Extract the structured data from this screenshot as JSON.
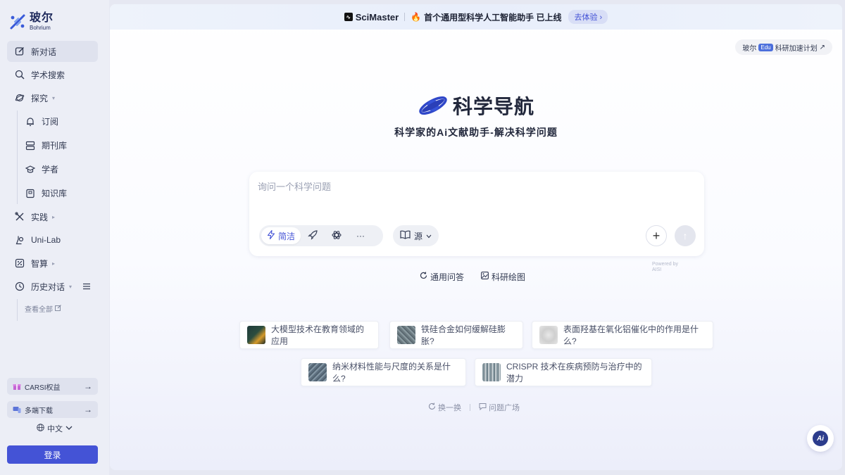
{
  "sidebar": {
    "logo_cn": "玻尔",
    "logo_en": "Bohrium",
    "items": [
      {
        "label": "新对话",
        "icon": "edit-icon"
      },
      {
        "label": "学术搜索",
        "icon": "search-icon"
      },
      {
        "label": "探究",
        "icon": "explore-icon"
      },
      {
        "label": "订阅",
        "icon": "bell-icon"
      },
      {
        "label": "期刊库",
        "icon": "database-icon"
      },
      {
        "label": "学者",
        "icon": "graduation-cap-icon"
      },
      {
        "label": "知识库",
        "icon": "notebook-icon"
      },
      {
        "label": "实践",
        "icon": "tools-icon"
      },
      {
        "label": "Uni-Lab",
        "icon": "lab-icon"
      },
      {
        "label": "智算",
        "icon": "compute-icon"
      },
      {
        "label": "历史对话",
        "icon": "history-icon"
      }
    ],
    "view_all": "查看全部",
    "carsi": "CARSI权益",
    "download": "多端下载",
    "language": "中文",
    "login": "登录"
  },
  "banner": {
    "product": "SciMaster",
    "title": "首个通用型科学人工智能助手 已上线",
    "try": "去体验"
  },
  "edu_chip": {
    "prefix": "玻尔",
    "badge": "Edu",
    "text": "科研加速计划"
  },
  "brand": {
    "title": "科学导航",
    "subtitle": "科学家的Ai文献助手-解决科学问题"
  },
  "ask": {
    "placeholder": "询问一个科学问题",
    "mode_active": "简洁",
    "source": "源",
    "powered": "Powered by",
    "powered_org": "AISI"
  },
  "quick_tabs": [
    "通用问答",
    "科研绘图"
  ],
  "suggestions": [
    "大模型技术在教育领域的应用",
    "铁硅合金如何缓解硅膨胀?",
    "表面羟基在氧化铝催化中的作用是什么?",
    "纳米材料性能与尺度的关系是什么?",
    "CRISPR 技术在疾病预防与治疗中的潜力"
  ],
  "bottom": {
    "refresh": "换一换",
    "plaza": "问题广场"
  },
  "fab": "Ai",
  "colors": {
    "accent": "#4453d6",
    "sidebar_bg": "#eceef6",
    "text": "#323a52"
  }
}
